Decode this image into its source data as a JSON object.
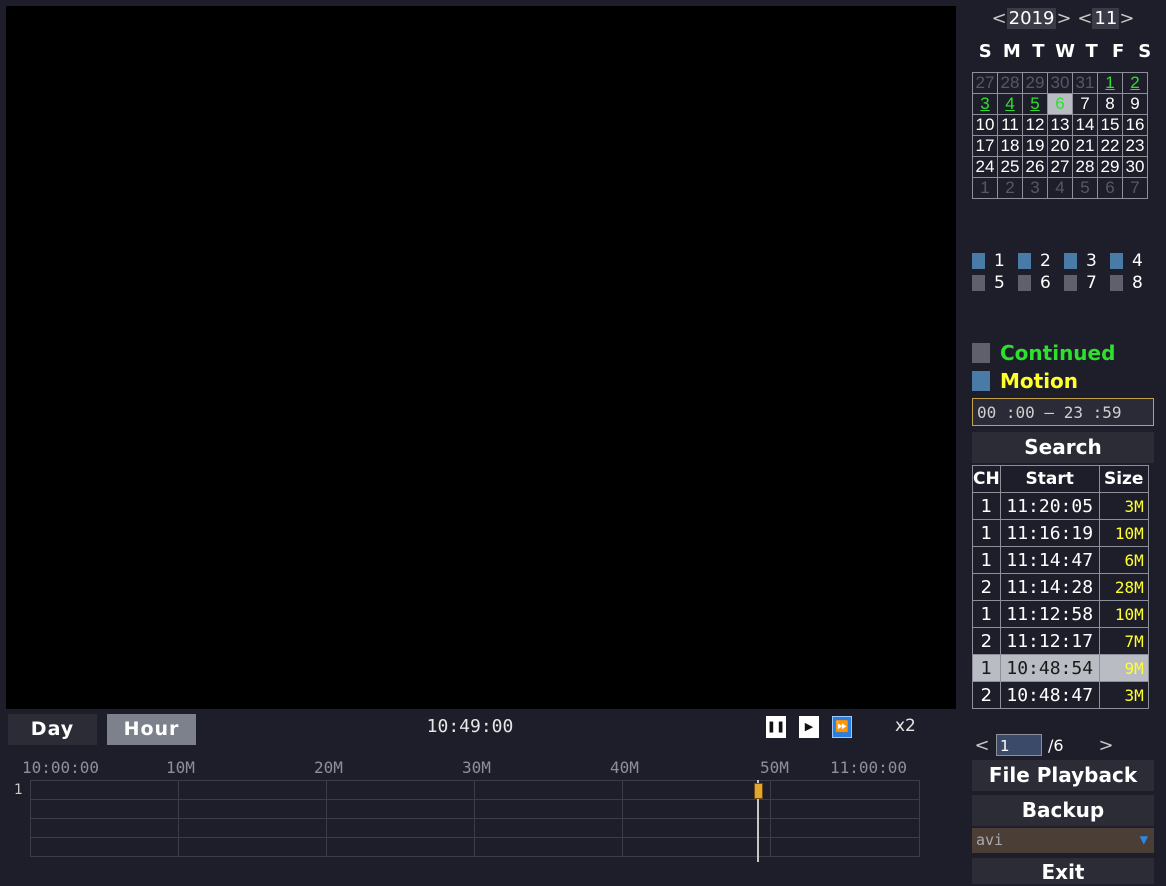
{
  "bottom": {
    "day_label": "Day",
    "hour_label": "Hour",
    "current_time": "10:49:00",
    "speed": "x2",
    "timeline": {
      "labels": [
        "10:00:00",
        "10M",
        "20M",
        "30M",
        "40M",
        "50M",
        "11:00:00"
      ],
      "channel": "1",
      "cursor_position": 0.82
    }
  },
  "calendar": {
    "year": "2019",
    "month": "11",
    "weekdays": [
      "S",
      "M",
      "T",
      "W",
      "T",
      "F",
      "S"
    ],
    "weeks": [
      [
        "27",
        "28",
        "29",
        "30",
        "31",
        "1",
        "2"
      ],
      [
        "3",
        "4",
        "5",
        "6",
        "7",
        "8",
        "9"
      ],
      [
        "10",
        "11",
        "12",
        "13",
        "14",
        "15",
        "16"
      ],
      [
        "17",
        "18",
        "19",
        "20",
        "21",
        "22",
        "23"
      ],
      [
        "24",
        "25",
        "26",
        "27",
        "28",
        "29",
        "30"
      ],
      [
        "1",
        "2",
        "3",
        "4",
        "5",
        "6",
        "7"
      ]
    ]
  },
  "channels": [
    "1",
    "2",
    "3",
    "4",
    "5",
    "6",
    "7",
    "8"
  ],
  "filters": {
    "continued": "Continued",
    "motion": "Motion",
    "time_range": "00 :00 – 23 :59"
  },
  "search_label": "Search",
  "table": {
    "headers": [
      "CH",
      "Start",
      "Size"
    ],
    "rows": [
      [
        "1",
        "11:20:05",
        "3M"
      ],
      [
        "1",
        "11:16:19",
        "10M"
      ],
      [
        "1",
        "11:14:47",
        "6M"
      ],
      [
        "2",
        "11:14:28",
        "28M"
      ],
      [
        "1",
        "11:12:58",
        "10M"
      ],
      [
        "2",
        "11:12:17",
        "7M"
      ],
      [
        "1",
        "10:48:54",
        "9M"
      ],
      [
        "2",
        "10:48:47",
        "3M"
      ]
    ]
  },
  "pager": {
    "page": "1",
    "total": "/6"
  },
  "file_playback_label": "File Playback",
  "backup_label": "Backup",
  "format_value": "avi",
  "exit_label": "Exit",
  "colors": {
    "green": "#2ee02e",
    "yellow": "#ffff2e",
    "accent": "#2a7fe0"
  }
}
